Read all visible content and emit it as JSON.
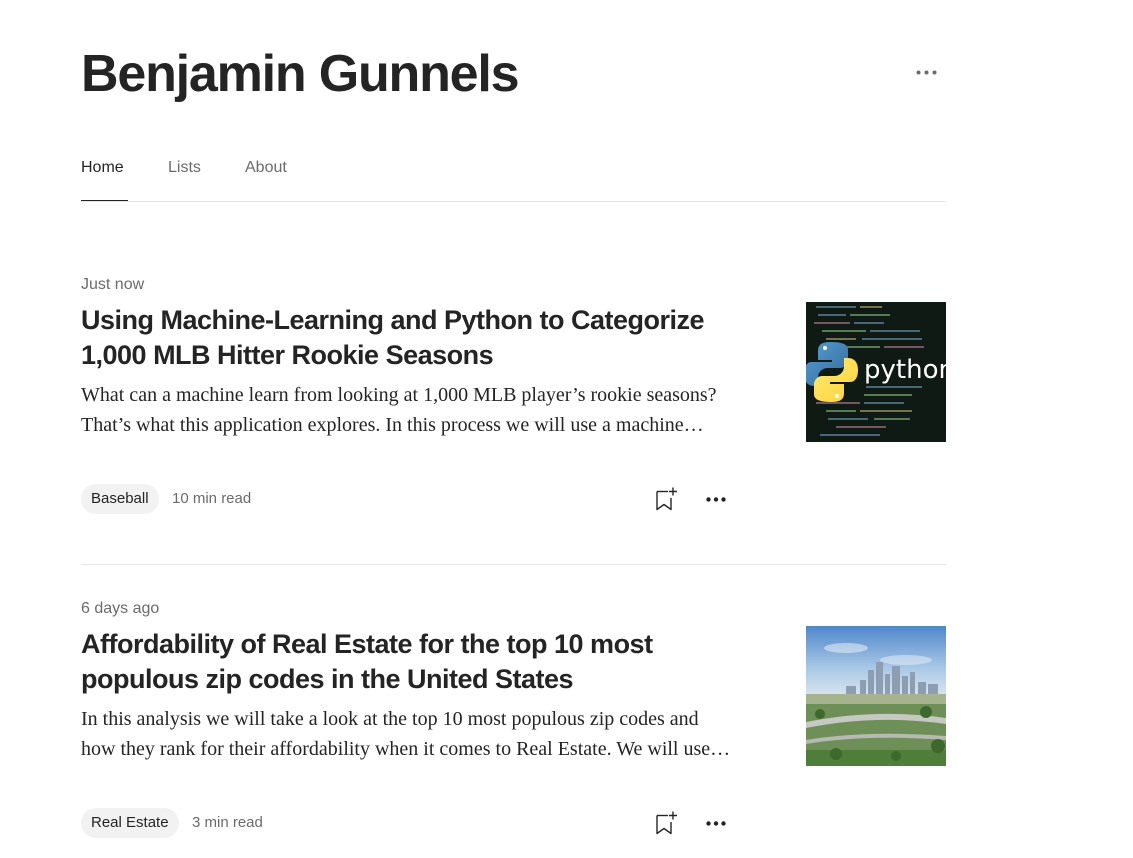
{
  "profile": {
    "name": "Benjamin Gunnels"
  },
  "header": {
    "more_icon": "more-horizontal-icon"
  },
  "tabs": [
    {
      "label": "Home",
      "active": true
    },
    {
      "label": "Lists",
      "active": false
    },
    {
      "label": "About",
      "active": false
    }
  ],
  "articles": [
    {
      "date": "Just now",
      "title": "Using Machine-Learning and Python to Categorize 1,000 MLB Hitter Rookie Seasons",
      "excerpt": "What can a machine learn from looking at 1,000 MLB player’s rookie seasons? That’s what this application explores. In this process we will use a machine learning model to group players.",
      "tag": "Baseball",
      "read_time": "10 min read",
      "thumbnail_text": "python",
      "thumbnail_icon": "python-logo-icon"
    },
    {
      "date": "6 days ago",
      "title": "Affordability of Real Estate for the top 10 most populous zip codes in the United States",
      "excerpt": "In this analysis we will take a look at the top 10 most populous zip codes and how they rank for their affordability when it comes to Real Estate. We will use publicly available data.",
      "tag": "Real Estate",
      "read_time": "3 min read",
      "thumbnail_icon": "city-skyline-photo"
    }
  ],
  "colors": {
    "text_primary": "#242424",
    "text_secondary": "#6b6b6b",
    "tag_background": "#f2f2f2",
    "divider": "#e6e6e6"
  }
}
